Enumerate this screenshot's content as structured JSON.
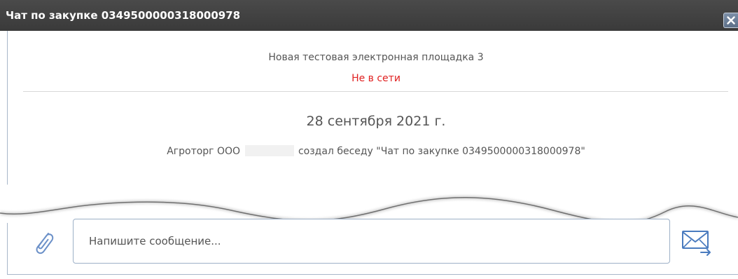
{
  "window": {
    "title": "Чат по закупке 0349500000318000978",
    "close_icon": "close-icon"
  },
  "contact": {
    "name": "Новая тестовая электронная площадка 3",
    "status": "Не в сети",
    "status_color": "#e02020"
  },
  "messages": {
    "date": "28 сентября 2021 г.",
    "system_prefix": "Агроторг ООО",
    "system_suffix": "создал беседу \"Чат по закупке 0349500000318000978\""
  },
  "composer": {
    "attach_icon": "paperclip-icon",
    "placeholder": "Напишите сообщение...",
    "value": "",
    "send_icon": "envelope-send-icon"
  },
  "colors": {
    "titlebar": "#3f3f3f",
    "accent": "#4a7bbf",
    "frame_border": "#a8b7c9"
  }
}
